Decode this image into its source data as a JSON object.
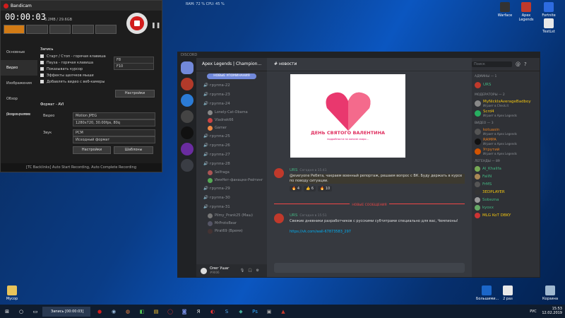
{
  "bandicam": {
    "title": "Bandicam",
    "timer": "00:00:03",
    "size": "6.2MB / 29.6GB",
    "sidebar": [
      "Основные",
      "Видео",
      "Изображения",
      "Обзор результатов",
      "О программе"
    ],
    "record_section": "Запись",
    "options": [
      {
        "label": "Старт / Стоп - горячая клавиша",
        "value": "F8"
      },
      {
        "label": "Пауза - горячая клавиша",
        "value": "F10"
      },
      {
        "label": "Показывать курсор",
        "value": ""
      },
      {
        "label": "Эффекты щелчков мыши",
        "value": ""
      },
      {
        "label": "Добавлять видео с веб-камеры",
        "value": ""
      }
    ],
    "settings_button": "Настройки",
    "format_section": "Формат - AVI",
    "video_label": "Видео",
    "video_codec": "Motion JPEG",
    "video_params": "1280x720, 30.00fps, 80q",
    "audio_label": "Звук",
    "audio_codec": "PCM",
    "audio_format": "Исходный формат",
    "settings_button2": "Настройки",
    "templates_button": "Шаблоны",
    "footer": "[TC Backlinks] Auto Start Recording, Auto Complete Recording"
  },
  "overlay_stats": "RAM: 72 % CPU: 45 %",
  "discord": {
    "window_title": "DISCORD",
    "server_name": "Apex Legends | Champion...",
    "new_mentions": "НОВЫЕ УПОМИНАНИЯ",
    "channel_title": "новости",
    "channels": [
      {
        "name": "группа-22"
      },
      {
        "name": "группа-23"
      },
      {
        "name": "группа-24",
        "users": [
          "Lonely-Cat-Obama",
          "Vladnek66",
          "Gamer"
        ]
      },
      {
        "name": "группа-25"
      },
      {
        "name": "группа-26"
      },
      {
        "name": "группа-27"
      },
      {
        "name": "группа-28",
        "users": [
          "Selfraga",
          "ИмяНет-фанацке-Рейтинг"
        ]
      },
      {
        "name": "группа-29"
      },
      {
        "name": "группа-30"
      },
      {
        "name": "группа-31",
        "users": [
          "Pilmy_Prank25 (Маш)",
          "MrProtoBear",
          "Pirat69 (Время)"
        ]
      }
    ],
    "banner_text": "ДЕНЬ СВЯТОГО ВАЛЕНТИНА",
    "banner_sub": "подробности на канале скоро...",
    "messages": [
      {
        "author": "URS",
        "time": "Сегодня в 15:41",
        "text": "@everyone Ребята, чакраем военный репортаж, решаем вопрос с ВК. Буду держать в курсе по поводу ситуации.",
        "reactions": [
          "4",
          "6",
          "10"
        ]
      },
      {
        "author": "URS",
        "time": "Сегодня в 15:51",
        "text": "Свежие дневники разработчиков с русскими субтитрами специально для вас, Чемпионы!",
        "link": "https://vk.com/wall-67873583_297"
      }
    ],
    "new_messages_divider": "НОВЫЕ СООБЩЕНИЯ",
    "input_placeholder": "",
    "user_name": "Олег Ушаг",
    "user_tag": "#9006",
    "search_placeholder": "Поиск",
    "members": {
      "admin_cat": "АДМИНЫ — 1",
      "admins": [
        "URS"
      ],
      "mod_cat": "МОДЕРАТОРЫ — 2",
      "mods": [
        {
          "name": "MyNickIsAverageBadboy",
          "sub": "Играет в Check.it"
        },
        {
          "name": "Scrd4",
          "sub": "Играет в Apex Legends"
        }
      ],
      "vid_cat": "ВИДЕО — 3",
      "vids": [
        {
          "name": "kotuasin",
          "sub": "Играет в Apex Legends"
        },
        {
          "name": "RAMPA",
          "sub": "Играет в Apex Legends"
        },
        {
          "name": "Угрутий",
          "sub": "Играет в Apex Legends"
        }
      ],
      "leg_cat": "ЛЕГЕНДЫ — 89",
      "legs": [
        "Al_Khalifa",
        "FallN",
        "FrMS",
        "3EDPLAYER",
        "Sobezna",
        "kyoxx",
        "MLG KoT DBKY"
      ]
    }
  },
  "desktop_icons": [
    "Warface",
    "Apex Legends",
    "Fortnite",
    "TextLst",
    "Мусор",
    "Большими...",
    "2 раз",
    "Корзина"
  ],
  "taskbar": {
    "task_label": "Запись [00:00:03]",
    "lang": "РУС",
    "time": "15:53",
    "date": "12.02.2019"
  }
}
